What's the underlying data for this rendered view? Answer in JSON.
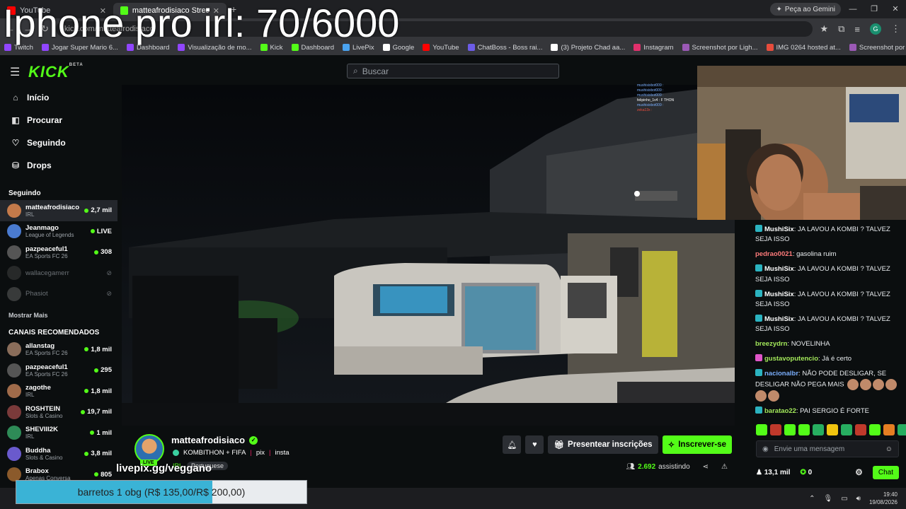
{
  "overlay": {
    "title": "Iphone pro irl: 70/6000"
  },
  "browser": {
    "tabs": [
      {
        "label": "YouTube",
        "color": "#ff0000"
      },
      {
        "label": "matteafrodisiaco Stream",
        "color": "#53fc18"
      }
    ],
    "gemini_button": "Peça ao Gemini",
    "url": "kick.com/matteafrodisiaco",
    "profile_initial": "G",
    "bookmarks": [
      {
        "label": "Twitch",
        "color": "#9146ff"
      },
      {
        "label": "Jogar Super Mario 6...",
        "color": "#9146ff"
      },
      {
        "label": "Dashboard",
        "color": "#9146ff"
      },
      {
        "label": "Visualização de mo...",
        "color": "#9146ff"
      },
      {
        "label": "Kick",
        "color": "#53fc18"
      },
      {
        "label": "Dashboard",
        "color": "#53fc18"
      },
      {
        "label": "LivePix",
        "color": "#4aa3f0"
      },
      {
        "label": "Google",
        "color": "#ffffff"
      },
      {
        "label": "YouTube",
        "color": "#ff0000"
      },
      {
        "label": "ChatBoss - Boss rai...",
        "color": "#6c5ce7"
      },
      {
        "label": "(3) Projeto Chad aa...",
        "color": "#ffffff"
      },
      {
        "label": "Instagram",
        "color": "#e1306c"
      },
      {
        "label": "Screenshot por Ligh...",
        "color": "#9b59b6"
      },
      {
        "label": "IMG 0264 hosted at...",
        "color": "#e74c3c"
      },
      {
        "label": "Screenshot por Ligh...",
        "color": "#9b59b6"
      }
    ]
  },
  "kick": {
    "logo": "KICK",
    "logo_sup": "BETA",
    "search_placeholder": "Buscar",
    "nav": [
      {
        "label": "Início",
        "icon": "home-icon",
        "glyph": "⌂"
      },
      {
        "label": "Procurar",
        "icon": "browse-icon",
        "glyph": "◧"
      },
      {
        "label": "Seguindo",
        "icon": "heart-icon",
        "glyph": "♡"
      },
      {
        "label": "Drops",
        "icon": "drops-icon",
        "glyph": "⛁"
      }
    ],
    "following_title": "Seguindo",
    "following": [
      {
        "name": "matteafrodisiaco",
        "category": "IRL",
        "viewers": "2,7 mil",
        "live": true,
        "avatar": "#c47a4a"
      },
      {
        "name": "Jeanmago",
        "category": "League of Legends",
        "viewers": "LIVE",
        "live": true,
        "avatar": "#4a7bd0"
      },
      {
        "name": "pazpeaceful1",
        "category": "EA Sports FC 26",
        "viewers": "308",
        "live": true,
        "avatar": "#555"
      },
      {
        "name": "wallacegamerr",
        "category": "",
        "viewers": "",
        "live": false,
        "avatar": "#444"
      },
      {
        "name": "Phasiot",
        "category": "",
        "viewers": "",
        "live": false,
        "avatar": "#666"
      }
    ],
    "show_more": "Mostrar Mais",
    "recommended_title": "CANAIS RECOMENDADOS",
    "recommended": [
      {
        "name": "allanstag",
        "category": "EA Sports FC 26",
        "viewers": "1,8 mil",
        "avatar": "#8a6d5a"
      },
      {
        "name": "pazpeaceful1",
        "category": "EA Sports FC 26",
        "viewers": "295",
        "avatar": "#555"
      },
      {
        "name": "zagothe",
        "category": "IRL",
        "viewers": "1,8 mil",
        "avatar": "#a06b4a"
      },
      {
        "name": "ROSHTEIN",
        "category": "Slots & Casino",
        "viewers": "19,7 mil",
        "avatar": "#7a3a3a"
      },
      {
        "name": "SHEVIII2K",
        "category": "IRL",
        "viewers": "1 mil",
        "avatar": "#2e8b57"
      },
      {
        "name": "Buddha",
        "category": "Slots & Casino",
        "viewers": "3,8 mil",
        "avatar": "#6a5acd"
      },
      {
        "name": "Brabox",
        "category": "Apenas Conversa",
        "viewers": "805",
        "avatar": "#8b5a2b"
      }
    ]
  },
  "mini_chat": [
    {
      "text": "mushisixbot009 :",
      "color": "#7aaefc"
    },
    {
      "text": "mushisixbot009 :",
      "color": "#7aaefc"
    },
    {
      "text": "mushisixbot009 :",
      "color": "#7aaefc"
    },
    {
      "text": "felipinho_1v4 : F THON",
      "color": "#ffffff"
    },
    {
      "text": "mushisixbot009 :",
      "color": "#7aaefc"
    },
    {
      "text": "zeka13x :",
      "color": "#e74c3c"
    }
  ],
  "stream": {
    "streamer": "matteafrodisiaco",
    "live_badge": "LIVE",
    "title_parts": [
      "KOMBITHON + FIFA",
      "pix",
      "insta"
    ],
    "category": "IRL",
    "language": "Portuguese",
    "overlay_link": "livepix.gg/veggano",
    "gift_label": "Presentear inscrições",
    "subscribe_label": "Inscrever-se",
    "viewers": "2.692",
    "viewers_suffix": "assistindo"
  },
  "chat": {
    "messages": [
      {
        "user": "MushiSix",
        "color": "#ffffff",
        "badge": "#2bb3c0",
        "text": "JA LAVOU A KOMBI ? TALVEZ SEJA ISSO"
      },
      {
        "user": "pedrao0021",
        "color": "#ff7b7b",
        "badge": "",
        "text": "gasolina ruim"
      },
      {
        "user": "MushiSix",
        "color": "#ffffff",
        "badge": "#2bb3c0",
        "text": "JA LAVOU A KOMBI ? TALVEZ SEJA ISSO"
      },
      {
        "user": "MushiSix",
        "color": "#ffffff",
        "badge": "#2bb3c0",
        "text": "JA LAVOU A KOMBI ? TALVEZ SEJA ISSO"
      },
      {
        "user": "MushiSix",
        "color": "#ffffff",
        "badge": "#2bb3c0",
        "text": "JA LAVOU A KOMBI ? TALVEZ SEJA ISSO"
      },
      {
        "user": "breezydrn",
        "color": "#a3e85a",
        "badge": "",
        "text": "NOVELINHA"
      },
      {
        "user": "gustavoputencio",
        "color": "#a3e85a",
        "badge": "#e056c8",
        "text": "Já é certo"
      },
      {
        "user": "nacionalbr",
        "color": "#7aaefc",
        "badge": "#2bb3c0",
        "text": "NÃO PODE DESLIGAR, SE DESLIGAR NÃO PEGA MAIS",
        "emotes": 6
      },
      {
        "user": "baratao22",
        "color": "#a3e85a",
        "badge": "#2bb3c0",
        "text": "PAI SERGIO É FORTE"
      }
    ],
    "emote_bar_colors": [
      "#53fc18",
      "#c0392b",
      "#53fc18",
      "#53fc18",
      "#27ae60",
      "#f1c40f",
      "#27ae60",
      "#c0392b",
      "#53fc18",
      "#e67e22",
      "#27ae60"
    ],
    "input_placeholder": "Envie uma mensagem",
    "followers": "13,1 mil",
    "points": "0",
    "chat_button": "Chat"
  },
  "donation": {
    "text": "barretos 1 obg (R$ 135,00/R$ 200,00)",
    "progress": 0.675,
    "color": "#3ab3d6"
  },
  "taskbar": {
    "time": "19:40",
    "date": "19/08/2026"
  }
}
